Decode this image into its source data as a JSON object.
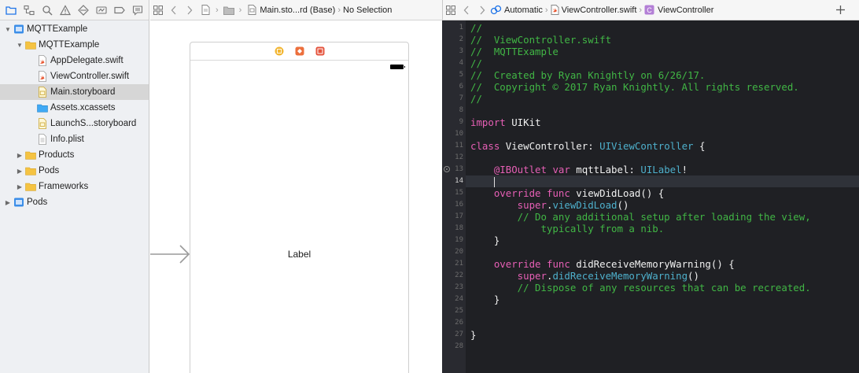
{
  "navigator": {
    "tree": [
      {
        "label": "MQTTExample",
        "level": 0,
        "disclosure": "open",
        "icon": "project-icon"
      },
      {
        "label": "MQTTExample",
        "level": 1,
        "disclosure": "open",
        "icon": "folder-icon"
      },
      {
        "label": "AppDelegate.swift",
        "level": 2,
        "disclosure": "none",
        "icon": "swift-file-icon"
      },
      {
        "label": "ViewController.swift",
        "level": 2,
        "disclosure": "none",
        "icon": "swift-file-icon"
      },
      {
        "label": "Main.storyboard",
        "level": 2,
        "disclosure": "none",
        "icon": "storyboard-file-icon",
        "selected": true
      },
      {
        "label": "Assets.xcassets",
        "level": 2,
        "disclosure": "none",
        "icon": "assets-folder-icon"
      },
      {
        "label": "LaunchS...storyboard",
        "level": 2,
        "disclosure": "none",
        "icon": "storyboard-file-icon"
      },
      {
        "label": "Info.plist",
        "level": 2,
        "disclosure": "none",
        "icon": "plist-file-icon"
      },
      {
        "label": "Products",
        "level": 1,
        "disclosure": "closed",
        "icon": "folder-icon"
      },
      {
        "label": "Pods",
        "level": 1,
        "disclosure": "closed",
        "icon": "folder-icon"
      },
      {
        "label": "Frameworks",
        "level": 1,
        "disclosure": "closed",
        "icon": "folder-icon"
      },
      {
        "label": "Pods",
        "level": 0,
        "disclosure": "closed",
        "icon": "project-icon"
      }
    ]
  },
  "canvas": {
    "jumpbar": {
      "file": "Main.sto...rd (Base)",
      "selection": "No Selection"
    },
    "label_text": "Label"
  },
  "editor": {
    "jumpbar": {
      "mode": "Automatic",
      "file": "ViewController.swift",
      "symbol": "ViewController"
    },
    "current_line": 14,
    "lines": [
      [
        {
          "t": "//",
          "c": "cmt"
        }
      ],
      [
        {
          "t": "//  ViewController.swift",
          "c": "cmt"
        }
      ],
      [
        {
          "t": "//  MQTTExample",
          "c": "cmt"
        }
      ],
      [
        {
          "t": "//",
          "c": "cmt"
        }
      ],
      [
        {
          "t": "//  Created by Ryan Knightly on 6/26/17.",
          "c": "cmt"
        }
      ],
      [
        {
          "t": "//  Copyright © 2017 Ryan Knightly. All rights reserved.",
          "c": "cmt"
        }
      ],
      [
        {
          "t": "//",
          "c": "cmt"
        }
      ],
      [],
      [
        {
          "t": "import",
          "c": "kw"
        },
        {
          "t": " UIKit",
          "c": "plain"
        }
      ],
      [],
      [
        {
          "t": "class",
          "c": "kw"
        },
        {
          "t": " ViewController: ",
          "c": "plain"
        },
        {
          "t": "UIViewController",
          "c": "type"
        },
        {
          "t": " {",
          "c": "plain"
        }
      ],
      [],
      [
        {
          "t": "    @IBOutlet",
          "c": "attr"
        },
        {
          "t": " ",
          "c": "plain"
        },
        {
          "t": "var",
          "c": "kw"
        },
        {
          "t": " mqttLabel: ",
          "c": "plain"
        },
        {
          "t": "UILabel",
          "c": "type"
        },
        {
          "t": "!",
          "c": "plain"
        }
      ],
      [
        {
          "t": "    ",
          "c": "plain"
        }
      ],
      [
        {
          "t": "    override",
          "c": "kw"
        },
        {
          "t": " ",
          "c": "plain"
        },
        {
          "t": "func",
          "c": "kw"
        },
        {
          "t": " viewDidLoad() {",
          "c": "plain"
        }
      ],
      [
        {
          "t": "        super",
          "c": "kw"
        },
        {
          "t": ".",
          "c": "plain"
        },
        {
          "t": "viewDidLoad",
          "c": "call"
        },
        {
          "t": "()",
          "c": "plain"
        }
      ],
      [
        {
          "t": "        // Do any additional setup after loading the view,",
          "c": "cmt"
        }
      ],
      [
        {
          "t": "            typically from a nib.",
          "c": "cmt"
        }
      ],
      [
        {
          "t": "    }",
          "c": "plain"
        }
      ],
      [],
      [
        {
          "t": "    override",
          "c": "kw"
        },
        {
          "t": " ",
          "c": "plain"
        },
        {
          "t": "func",
          "c": "kw"
        },
        {
          "t": " didReceiveMemoryWarning() {",
          "c": "plain"
        }
      ],
      [
        {
          "t": "        super",
          "c": "kw"
        },
        {
          "t": ".",
          "c": "plain"
        },
        {
          "t": "didReceiveMemoryWarning",
          "c": "call"
        },
        {
          "t": "()",
          "c": "plain"
        }
      ],
      [
        {
          "t": "        // Dispose of any resources that can be recreated.",
          "c": "cmt"
        }
      ],
      [
        {
          "t": "    }",
          "c": "plain"
        }
      ],
      [],
      [],
      [
        {
          "t": "}",
          "c": "plain"
        }
      ],
      [],
      []
    ],
    "gutter_numbers": [
      "1",
      "2",
      "3",
      "4",
      "5",
      "6",
      "7",
      "8",
      "9",
      "10",
      "11",
      "12",
      "13",
      "14",
      "15",
      "16",
      "17",
      "18",
      "19",
      "20",
      "21",
      "22",
      "23",
      "24",
      "25",
      "26",
      "27",
      "28",
      ""
    ],
    "outlet_line": 13
  },
  "colors": {
    "editor_bg": "#1f2024",
    "comment": "#41b645",
    "keyword": "#e65fb5",
    "type": "#4eb0cc",
    "selection_gray": "#d6d6d6",
    "folder_yellow": "#f5c342"
  }
}
